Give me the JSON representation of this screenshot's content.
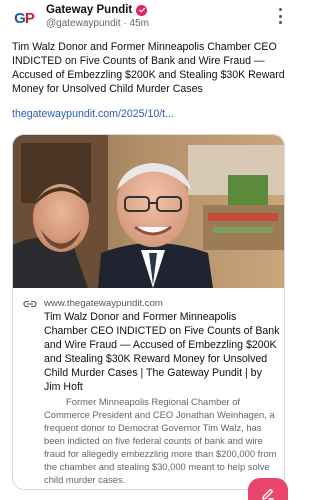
{
  "post": {
    "author": {
      "name": "Gateway Pundit",
      "handle": "@gatewaypundit",
      "time": "45m",
      "avatar_text_g": "G",
      "avatar_text_p": "P"
    },
    "text": "Tim Walz Donor and Former Minneapolis Chamber CEO INDICTED on Five Counts of Bank and Wire Fraud — Accused of Embezzling $200K and Stealing $30K Reward Money for Unsolved Child Murder Cases",
    "link_text": "thegatewaypundit.com/2025/10/t...",
    "colors": {
      "verified": "#e0245e",
      "link": "#2a5db0",
      "fab": "#e8476b"
    }
  },
  "card": {
    "domain": "www.thegatewaypundit.com",
    "title": "Tim Walz Donor and Former Minneapolis Chamber CEO INDICTED on Five Counts of Bank and Wire Fraud — Accused of Embezzling $200K and Stealing $30K Reward Money for Unsolved Child Murder Cases | The Gateway Pundit | by Jim Hoft",
    "description": "Former Minneapolis Regional Chamber of Commerce President and CEO Jonathan Weinhagen, a frequent donor to Democrat Governor Tim Walz, has been indicted on five federal counts of bank and wire fraud for allegedly embezzling more than $200,000 from the chamber and stealing $30,000 meant to help solve child murder cases."
  },
  "icons": [
    "verified-badge-icon",
    "more-options-icon",
    "link-icon",
    "compose-icon"
  ]
}
